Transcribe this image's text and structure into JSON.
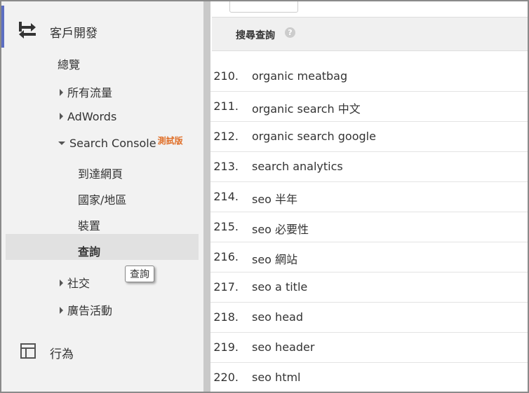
{
  "sidebar": {
    "section_title": "客戶開發",
    "icon": "acquisition-arrows-icon",
    "items": {
      "overview": "總覽",
      "all_traffic": "所有流量",
      "adwords": "AdWords",
      "search_console": "Search Console",
      "beta": "測試版",
      "landing_pages": "到達網頁",
      "countries": "國家/地區",
      "devices": "裝置",
      "queries": "查詢",
      "social": "社交",
      "campaigns": "廣告活動"
    },
    "behavior": "行為",
    "behavior_icon": "behavior-layout-icon",
    "tooltip": "查詢"
  },
  "table": {
    "header": "搜尋查詢",
    "help_icon": "?",
    "rows": [
      {
        "num": "210.",
        "query": "organic meatbag"
      },
      {
        "num": "211.",
        "query": "organic search 中文"
      },
      {
        "num": "212.",
        "query": "organic search google"
      },
      {
        "num": "213.",
        "query": "search analytics"
      },
      {
        "num": "214.",
        "query": "seo 半年"
      },
      {
        "num": "215.",
        "query": "seo 必要性"
      },
      {
        "num": "216.",
        "query": "seo 網站"
      },
      {
        "num": "217.",
        "query": "seo a title"
      },
      {
        "num": "218.",
        "query": "seo head"
      },
      {
        "num": "219.",
        "query": "seo header"
      },
      {
        "num": "220.",
        "query": "seo html"
      }
    ]
  },
  "colors": {
    "accent": "#5c6ec2",
    "beta": "#e0702a",
    "selected_bg": "#e1e1e1"
  }
}
